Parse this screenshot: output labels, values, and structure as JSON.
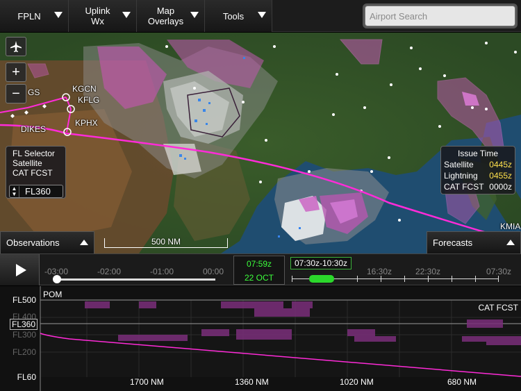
{
  "toolbar": {
    "fpln_label": "FPLN",
    "uplink_label": "Uplink Wx",
    "overlays_label": "Map Overlays",
    "tools_label": "Tools",
    "search_placeholder": "Airport Search"
  },
  "map": {
    "waypoints": [
      "GS",
      "KGCN",
      "KFLG",
      "DIKES",
      "KPHX",
      "KMIA"
    ],
    "fl_selector": {
      "title": "FL Selector",
      "line2": "Satellite",
      "line3": "CAT FCST",
      "value": "FL360"
    },
    "issue_time": {
      "title": "Issue Time",
      "rows": [
        {
          "label": "Satellite",
          "value": "0445z",
          "color": "#ffe14d"
        },
        {
          "label": "Lightning",
          "value": "0455z",
          "color": "#ffe14d"
        },
        {
          "label": "CAT FCST",
          "value": "0000z",
          "color": "#ffffff"
        }
      ]
    },
    "scale_label": "500 NM",
    "observations_label": "Observations",
    "forecasts_label": "Forecasts",
    "route_color": "#ff2bd8"
  },
  "timeline": {
    "past_labels": [
      "-03:00",
      "-02:00",
      "-01:00",
      "00:00"
    ],
    "current_time": "07:59z",
    "current_date": "22 OCT",
    "forecast_range": "07:30z-10:30z",
    "forecast_labels": [
      "16:30z",
      "22:30z",
      "07:30z"
    ],
    "accent_color": "#3cff3c"
  },
  "profile": {
    "station": "POM",
    "layer_label": "CAT FCST",
    "y_labels": [
      "FL500",
      "FL400",
      "FL360",
      "FL300",
      "FL200",
      "FL60"
    ],
    "x_labels": [
      "1700 NM",
      "1360 NM",
      "1020 NM",
      "680 NM"
    ]
  }
}
